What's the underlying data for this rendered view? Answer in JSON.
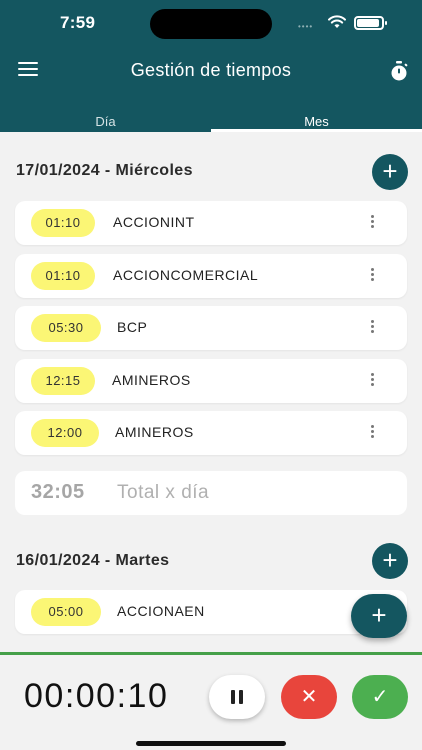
{
  "status_bar": {
    "time": "7:59"
  },
  "header": {
    "title": "Gestión de tiempos"
  },
  "tabs": [
    {
      "label": "Día"
    },
    {
      "label": "Mes"
    }
  ],
  "days": [
    {
      "date_label": "17/01/2024 - Miércoles",
      "entries": [
        {
          "duration": "01:10",
          "code": "ACCIONINT"
        },
        {
          "duration": "01:10",
          "code": "ACCIONCOMERCIAL"
        },
        {
          "duration": "05:30",
          "code": "BCP"
        },
        {
          "duration": "12:15",
          "code": "AMINEROS"
        },
        {
          "duration": "12:00",
          "code": "AMINEROS"
        }
      ],
      "total": {
        "value": "32:05",
        "label": "Total x día"
      }
    },
    {
      "date_label": "16/01/2024 - Martes",
      "entries": [
        {
          "duration": "05:00",
          "code": "ACCIONAEN"
        }
      ]
    }
  ],
  "timer": {
    "elapsed": "00:00:10"
  },
  "colors": {
    "primary": "#145660",
    "pill": "#fbf675",
    "cancel": "#e8453c",
    "confirm": "#4caf50"
  },
  "icons": {
    "menu": "hamburger-icon",
    "timer": "stopwatch-icon",
    "add": "plus-icon",
    "more": "kebab-icon",
    "pause": "pause-icon",
    "cancel": "close-icon",
    "confirm": "check-icon"
  }
}
